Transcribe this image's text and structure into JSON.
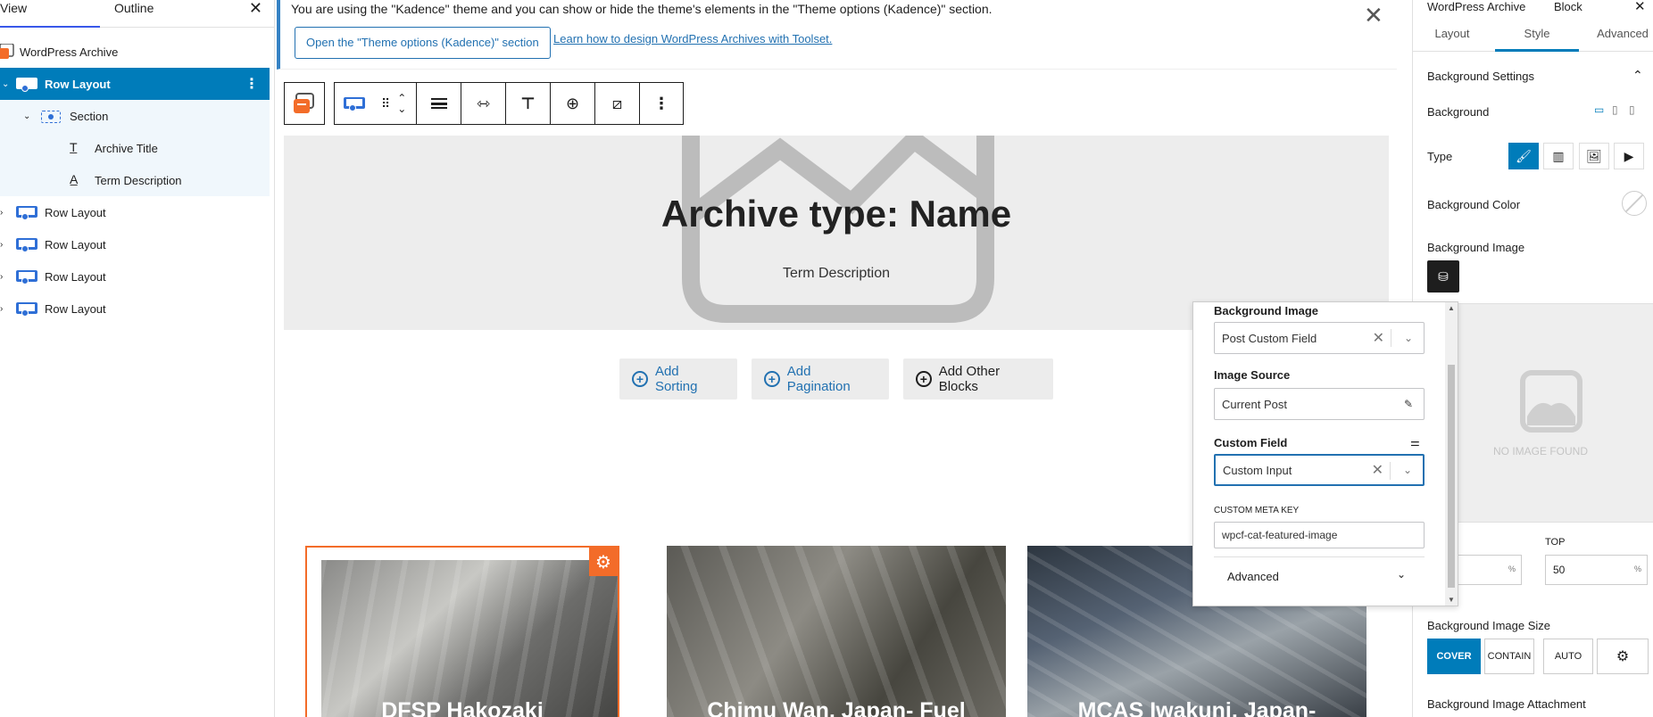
{
  "left": {
    "tab_view": "View",
    "tab_outline": "Outline",
    "tree": {
      "root": "WordPress Archive",
      "row1": "Row Layout",
      "section": "Section",
      "archive_title": "Archive Title",
      "term_description": "Term Description",
      "row2": "Row Layout",
      "row3": "Row Layout",
      "row4": "Row Layout",
      "row5": "Row Layout"
    }
  },
  "notice": {
    "message": "You are using the \"Kadence\" theme and you can show or hide the theme's elements in the \"Theme options (Kadence)\" section.",
    "button": "Open the \"Theme options (Kadence)\" section",
    "link": "Learn how to design WordPress Archives with Toolset."
  },
  "hero": {
    "title": "Archive type: Name",
    "description": "Term Description"
  },
  "actions": {
    "add_sorting": "Add Sorting",
    "add_pagination": "Add Pagination",
    "add_other": "Add Other Blocks"
  },
  "cards": [
    {
      "title": "DFSP Hakozaki"
    },
    {
      "title": "Chimu Wan, Japan- Fuel"
    },
    {
      "title": "MCAS Iwakuni, Japan-"
    }
  ],
  "popover": {
    "bg_image_label": "Background Image",
    "bg_image_value": "Post Custom Field",
    "image_source_label": "Image Source",
    "image_source_value": "Current Post",
    "custom_field_label": "Custom Field",
    "custom_field_value": "Custom Input",
    "meta_key_label": "CUSTOM META KEY",
    "meta_key_value": "wpcf-cat-featured-image",
    "advanced_label": "Advanced"
  },
  "right": {
    "header_title": "WordPress Archive",
    "header_tab": "Block",
    "tabs": {
      "layout": "Layout",
      "style": "Style",
      "advanced": "Advanced"
    },
    "section_title": "Background Settings",
    "background_label": "Background",
    "type_label": "Type",
    "bg_color_label": "Background Color",
    "bg_image_label": "Background Image",
    "no_image": "NO IMAGE FOUND",
    "top_label": "TOP",
    "top_value": "50",
    "left_unit": "%",
    "top_unit": "%",
    "size_label": "Background Image Size",
    "size_cover": "COVER",
    "size_contain": "CONTAIN",
    "size_auto": "AUTO",
    "attachment_label": "Background Image Attachment"
  },
  "colors": {
    "accent": "#007cba",
    "toolset_orange": "#f36c29",
    "link_blue": "#2271b1"
  }
}
